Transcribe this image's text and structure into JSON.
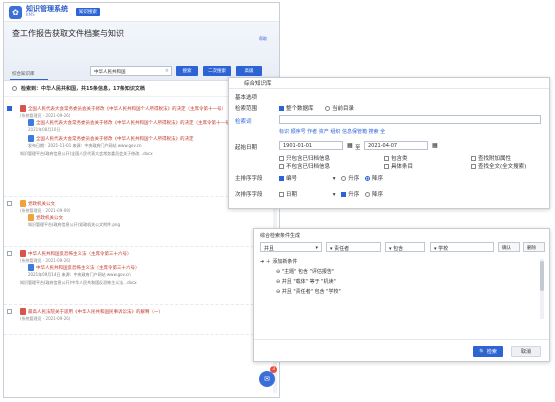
{
  "app": {
    "title": "知识管理系统",
    "subtitle": "KMS",
    "mode_badge": "知识搜索"
  },
  "banner": {
    "title": "查工作报告获取文件档案与知识",
    "help": "帮助",
    "tab": "综合知识库",
    "search_value": "中华人民共和国",
    "search_button": "搜索",
    "second_search_button": "二次搜索",
    "advanced_button": "高级"
  },
  "results": {
    "summary": "检索到：中华人民共和国，共15条信息，17条知识文档",
    "items": [
      {
        "title": "全国人民代表大会常务委员会关于修改《中华人民共和国个人所得税法》的决定（主席令第十一号）",
        "meta": "(系统管理员 - 2021-09-26)",
        "sub1": "全国人民代表大会常务委员会关于修改《中华人民共和国个人所得税法》的决定（主席令第十一号）",
        "sub1_meta": "2021年08月10日",
        "sub2": "全国人民代表大会常务委员会关于修改《中华人民共和国个人所得税法》的决定",
        "sub2_meta": "发布日期：2021-11-01 来源：中央政府门户网站 www.gov.cn",
        "footer": "知识管理平台(政府信息公开)全国人民代表大会常务委员会关于修改…docx"
      },
      {
        "title": "党政机关公文",
        "meta": "(系统管理员 - 2021-09-09)",
        "sub1": "党政机关公文",
        "sub1_meta": "知识管理平台(政府信息公开)党政机关公文附件.png"
      },
      {
        "title": "中华人民共和国反恐怖主义法（主席令第三十六号）",
        "meta": "(系统管理员 - 2021-09-26)",
        "sub1": "中华人民共和国反恐怖主义法（主席令第三十六号）",
        "sub1_meta": "2021年09月14日 来源：中央政府门户网站 www.gov.cn",
        "footer": "知识管理平台(政府信息公开)中华人民共和国反恐怖主义法…docx"
      },
      {
        "title": "最高人民法院关于适用《中华人民共和国民事诉讼法》的解释（一）",
        "meta": "(系统管理员 - 2021-09-26)"
      }
    ]
  },
  "fab": {
    "badge": "3"
  },
  "kb_panel": {
    "title": "综合知识库",
    "basic_options": "基本选项",
    "search_range_label": "检索范围",
    "range_all": "整个数据库",
    "range_current": "当前目录",
    "search_terms_label": "检索词",
    "quick_terms": "标识 顺序号 作者 资产 组织 信息保管箱 搜索 全",
    "date_label": "起始日期",
    "date_from": "1901-01-01",
    "date_to_label": "至",
    "date_to": "2021-04-07",
    "opt1": "只包含已归档信息",
    "opt2": "不包含已归档信息",
    "opt3": "包含类",
    "opt4": "具体条目",
    "opt5": "查找附加属性",
    "opt6": "查找全文(全文搜索)",
    "primary_sort_label": "主排序字段",
    "primary_sort_field": "编号",
    "secondary_sort_label": "次排序字段",
    "secondary_sort_field": "日期",
    "asc": "升序",
    "desc": "降序"
  },
  "cond_panel": {
    "title": "综合检索条件生成",
    "op_select": "并且",
    "field_select": "责任者",
    "rel_select": "包含",
    "value": "学校",
    "confirm": "确认",
    "delete": "删除",
    "add_condition": "添加新条件",
    "conditions": [
      "\"主题\" 包含 \"评估报告\"",
      "并且 \"载体\" 等于 \"机读\"",
      "并且 \"责任者\" 包含 \"学校\""
    ],
    "search_button": "检索",
    "cancel_button": "取消"
  }
}
